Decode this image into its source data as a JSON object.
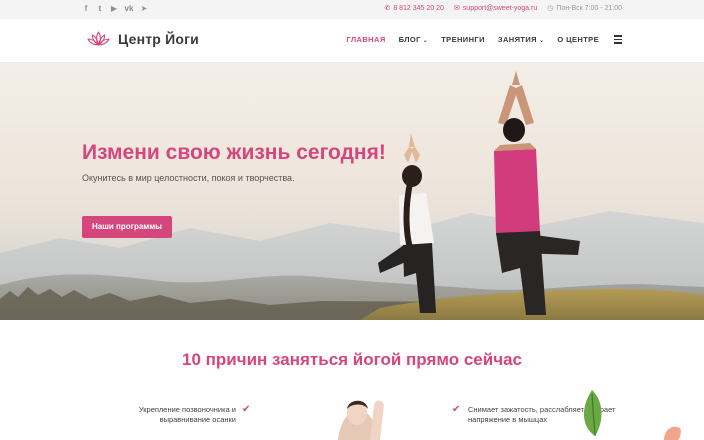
{
  "topbar": {
    "social": [
      {
        "icon": "facebook-icon",
        "glyph": "f"
      },
      {
        "icon": "twitter-icon",
        "glyph": "t"
      },
      {
        "icon": "youtube-icon",
        "glyph": "▶"
      },
      {
        "icon": "vk-icon",
        "glyph": "vk"
      },
      {
        "icon": "telegram-icon",
        "glyph": "➤"
      }
    ],
    "phone": "8 812 345 20 20",
    "email": "support@sweet-yoga.ru",
    "hours": "Пон-Вск 7:00 - 21:00"
  },
  "header": {
    "logo_text": "Центр Йоги",
    "nav": {
      "home": "ГЛАВНАЯ",
      "blog": "БЛОГ",
      "trainings": "ТРЕНИНГИ",
      "classes": "ЗАНЯТИЯ",
      "about": "О ЦЕНТРЕ"
    }
  },
  "hero": {
    "title": "Измени свою жизнь сегодня!",
    "subtitle": "Окунитесь в мир целостности, покоя и творчества.",
    "button": "Наши программы"
  },
  "reasons": {
    "title": "10 причин заняться йогой прямо сейчас",
    "left_item": "Укрепление позвоночника и выравнивание осанки",
    "right_item": "Снимает зажатость, расслабляет, убирает напряжение в мышцах"
  },
  "colors": {
    "accent": "#d5467c",
    "topbar_bg": "#f4f4f4",
    "text": "#333333"
  }
}
